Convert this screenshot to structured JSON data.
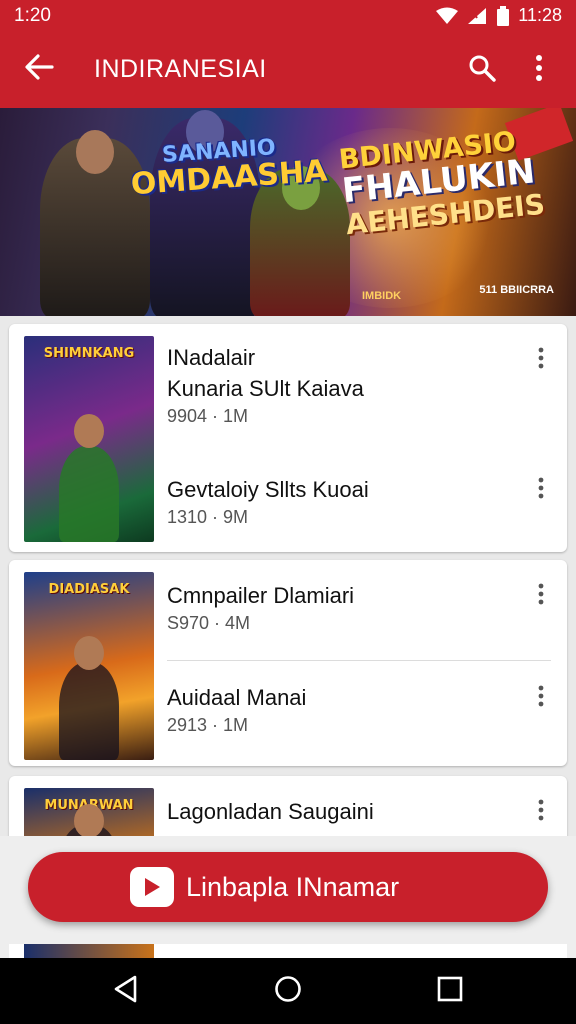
{
  "status_bar": {
    "time": "1:20",
    "right_text": "11:28",
    "icons": [
      "wifi-icon",
      "signal-icon",
      "battery-icon"
    ]
  },
  "app_bar": {
    "title": "INDIRANESIAI",
    "back_icon": "arrow-left-icon",
    "search_icon": "search-icon",
    "more_icon": "more-vertical-icon"
  },
  "banner": {
    "left_title_line1": "SANANIO",
    "left_title_line2": "OMDAASHA",
    "right_title_line1": "BDINWASIO",
    "right_title_line2": "FHALUKIN",
    "right_title_line3": "AEHESHDEIS",
    "small_text_left": "IMBIDK",
    "small_text_right": "511 BBIICRRA"
  },
  "cards": [
    {
      "thumb_caption": "SHIMNKANG",
      "items": [
        {
          "title_line1": "INadalair",
          "title_line2": "Kunaria SUlt Kaiava",
          "meta": "9904 · 1M"
        },
        {
          "title_line1": "Gevtaloiy Sllts Kuoai",
          "meta": "1310 · 9M"
        }
      ]
    },
    {
      "thumb_caption": "DIADIASAK",
      "items": [
        {
          "title_line1": "Cmnpailer Dlamiari",
          "meta": "S970 · 4M"
        },
        {
          "title_line1": "Auidaal Manai",
          "meta": "2913 · 1M"
        }
      ]
    },
    {
      "thumb_caption": "MUNARWAN",
      "items": [
        {
          "title_line1": "Lagonladan Saugaini",
          "meta": ""
        }
      ]
    }
  ],
  "fab": {
    "label": "Linbapla INnamar",
    "icon": "play-icon"
  },
  "nav_bar": {
    "icons": [
      "nav-back-icon",
      "nav-home-icon",
      "nav-recents-icon"
    ]
  },
  "colors": {
    "primary_red": "#c8202b",
    "text_primary": "#111111",
    "text_secondary": "#555555",
    "background": "#e9e9e9"
  }
}
